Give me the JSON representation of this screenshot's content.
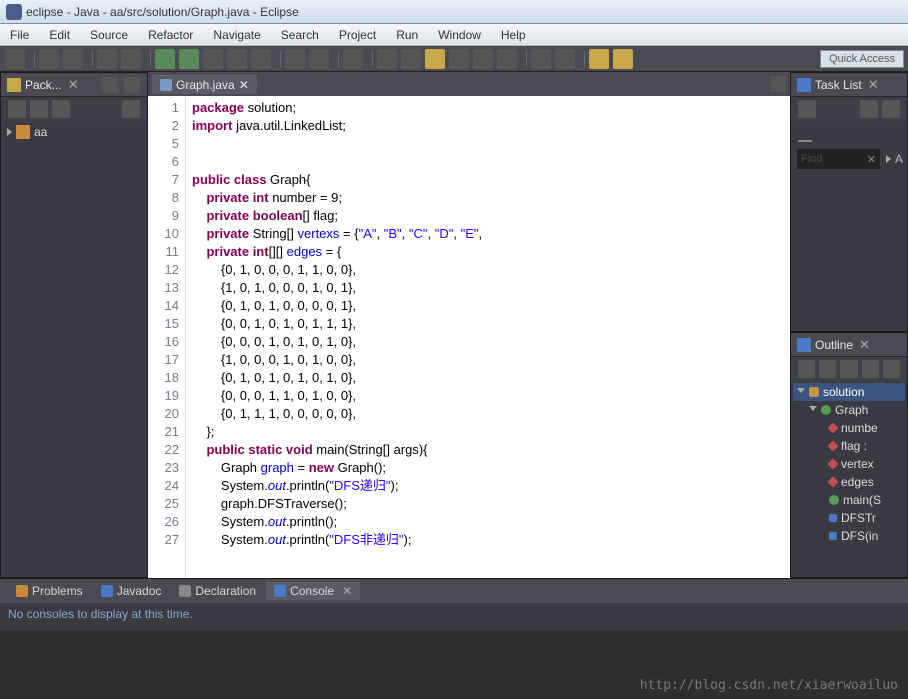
{
  "window": {
    "title": "eclipse - Java - aa/src/solution/Graph.java - Eclipse"
  },
  "menu": {
    "items": [
      "File",
      "Edit",
      "Source",
      "Refactor",
      "Navigate",
      "Search",
      "Project",
      "Run",
      "Window",
      "Help"
    ]
  },
  "toolbar": {
    "quick_access": "Quick Access"
  },
  "package_explorer": {
    "title": "Pack...",
    "items": [
      {
        "name": "aa"
      }
    ]
  },
  "editor": {
    "tab": "Graph.java",
    "lines": [
      {
        "n": 1,
        "t": [
          {
            "c": "kw",
            "v": "package"
          },
          {
            "c": "",
            "v": " solution;"
          }
        ]
      },
      {
        "n": 2,
        "t": [
          {
            "c": "kw",
            "v": "import"
          },
          {
            "c": "",
            "v": " java.util.LinkedList;"
          }
        ]
      },
      {
        "n": 5,
        "t": []
      },
      {
        "n": 6,
        "t": []
      },
      {
        "n": 7,
        "t": [
          {
            "c": "kw",
            "v": "public class"
          },
          {
            "c": "",
            "v": " Graph{"
          }
        ]
      },
      {
        "n": 8,
        "t": [
          {
            "c": "",
            "v": "    "
          },
          {
            "c": "kw",
            "v": "private int"
          },
          {
            "c": "",
            "v": " number = 9;"
          }
        ]
      },
      {
        "n": 9,
        "t": [
          {
            "c": "",
            "v": "    "
          },
          {
            "c": "kw",
            "v": "private boolean"
          },
          {
            "c": "",
            "v": "[] flag;"
          }
        ]
      },
      {
        "n": 10,
        "t": [
          {
            "c": "",
            "v": "    "
          },
          {
            "c": "kw",
            "v": "private"
          },
          {
            "c": "",
            "v": " String[] "
          },
          {
            "c": "fld",
            "v": "vertexs"
          },
          {
            "c": "",
            "v": " = {"
          },
          {
            "c": "str",
            "v": "\"A\""
          },
          {
            "c": "",
            "v": ", "
          },
          {
            "c": "str",
            "v": "\"B\""
          },
          {
            "c": "",
            "v": ", "
          },
          {
            "c": "str",
            "v": "\"C\""
          },
          {
            "c": "",
            "v": ", "
          },
          {
            "c": "str",
            "v": "\"D\""
          },
          {
            "c": "",
            "v": ", "
          },
          {
            "c": "str",
            "v": "\"E\""
          },
          {
            "c": "",
            "v": ","
          }
        ]
      },
      {
        "n": 11,
        "t": [
          {
            "c": "",
            "v": "    "
          },
          {
            "c": "kw",
            "v": "private int"
          },
          {
            "c": "",
            "v": "[][] "
          },
          {
            "c": "fld",
            "v": "edges"
          },
          {
            "c": "",
            "v": " = {"
          }
        ]
      },
      {
        "n": 12,
        "t": [
          {
            "c": "",
            "v": "        {0, 1, 0, 0, 0, 1, 1, 0, 0},"
          }
        ]
      },
      {
        "n": 13,
        "t": [
          {
            "c": "",
            "v": "        {1, 0, 1, 0, 0, 0, 1, 0, 1},"
          }
        ]
      },
      {
        "n": 14,
        "t": [
          {
            "c": "",
            "v": "        {0, 1, 0, 1, 0, 0, 0, 0, 1},"
          }
        ]
      },
      {
        "n": 15,
        "t": [
          {
            "c": "",
            "v": "        {0, 0, 1, 0, 1, 0, 1, 1, 1},"
          }
        ]
      },
      {
        "n": 16,
        "t": [
          {
            "c": "",
            "v": "        {0, 0, 0, 1, 0, 1, 0, 1, 0},"
          }
        ]
      },
      {
        "n": 17,
        "t": [
          {
            "c": "",
            "v": "        {1, 0, 0, 0, 1, 0, 1, 0, 0},"
          }
        ]
      },
      {
        "n": 18,
        "t": [
          {
            "c": "",
            "v": "        {0, 1, 0, 1, 0, 1, 0, 1, 0},"
          }
        ]
      },
      {
        "n": 19,
        "t": [
          {
            "c": "",
            "v": "        {0, 0, 0, 1, 1, 0, 1, 0, 0},"
          }
        ]
      },
      {
        "n": 20,
        "t": [
          {
            "c": "",
            "v": "        {0, 1, 1, 1, 0, 0, 0, 0, 0},"
          }
        ]
      },
      {
        "n": 21,
        "t": [
          {
            "c": "",
            "v": "    };"
          }
        ]
      },
      {
        "n": 22,
        "t": [
          {
            "c": "",
            "v": "    "
          },
          {
            "c": "kw",
            "v": "public static void"
          },
          {
            "c": "",
            "v": " main(String[] args){"
          }
        ]
      },
      {
        "n": 23,
        "t": [
          {
            "c": "",
            "v": "        Graph "
          },
          {
            "c": "fld",
            "v": "graph"
          },
          {
            "c": "",
            "v": " = "
          },
          {
            "c": "kw",
            "v": "new"
          },
          {
            "c": "",
            "v": " Graph();"
          }
        ]
      },
      {
        "n": 24,
        "t": [
          {
            "c": "",
            "v": "        System."
          },
          {
            "c": "fld-it",
            "v": "out"
          },
          {
            "c": "",
            "v": ".println("
          },
          {
            "c": "str",
            "v": "\"DFS递归\""
          },
          {
            "c": "",
            "v": ");"
          }
        ]
      },
      {
        "n": 25,
        "t": [
          {
            "c": "",
            "v": "        graph.DFSTraverse();"
          }
        ]
      },
      {
        "n": 26,
        "t": [
          {
            "c": "",
            "v": "        System."
          },
          {
            "c": "fld-it",
            "v": "out"
          },
          {
            "c": "",
            "v": ".println();"
          }
        ]
      },
      {
        "n": 27,
        "t": [
          {
            "c": "",
            "v": "        System."
          },
          {
            "c": "fld-it",
            "v": "out"
          },
          {
            "c": "",
            "v": ".println("
          },
          {
            "c": "str",
            "v": "\"DFS非递归\""
          },
          {
            "c": "",
            "v": ");"
          }
        ]
      }
    ]
  },
  "tasklist": {
    "title": "Task List",
    "find": "Find"
  },
  "outline": {
    "title": "Outline",
    "items": [
      {
        "l": 0,
        "icon": "pkg",
        "label": "solution",
        "sel": true
      },
      {
        "l": 1,
        "icon": "cls",
        "label": "Graph"
      },
      {
        "l": 2,
        "icon": "fld",
        "label": "numbe"
      },
      {
        "l": 2,
        "icon": "fld",
        "label": "flag : "
      },
      {
        "l": 2,
        "icon": "fld",
        "label": "vertex"
      },
      {
        "l": 2,
        "icon": "fld",
        "label": "edges"
      },
      {
        "l": 2,
        "icon": "mth",
        "label": "main(S"
      },
      {
        "l": 2,
        "icon": "mthb",
        "label": "DFSTr"
      },
      {
        "l": 2,
        "icon": "mthb",
        "label": "DFS(in"
      }
    ]
  },
  "bottom": {
    "tabs": [
      {
        "label": "Problems",
        "icon": "#c88a3a"
      },
      {
        "label": "Javadoc",
        "icon": "#4a7ac5"
      },
      {
        "label": "Declaration",
        "icon": "#888"
      },
      {
        "label": "Console",
        "icon": "#4a7ac5",
        "active": true,
        "closable": true
      }
    ],
    "content": "No consoles to display at this time."
  },
  "watermark": "http://blog.csdn.net/xiaerwoailuo"
}
